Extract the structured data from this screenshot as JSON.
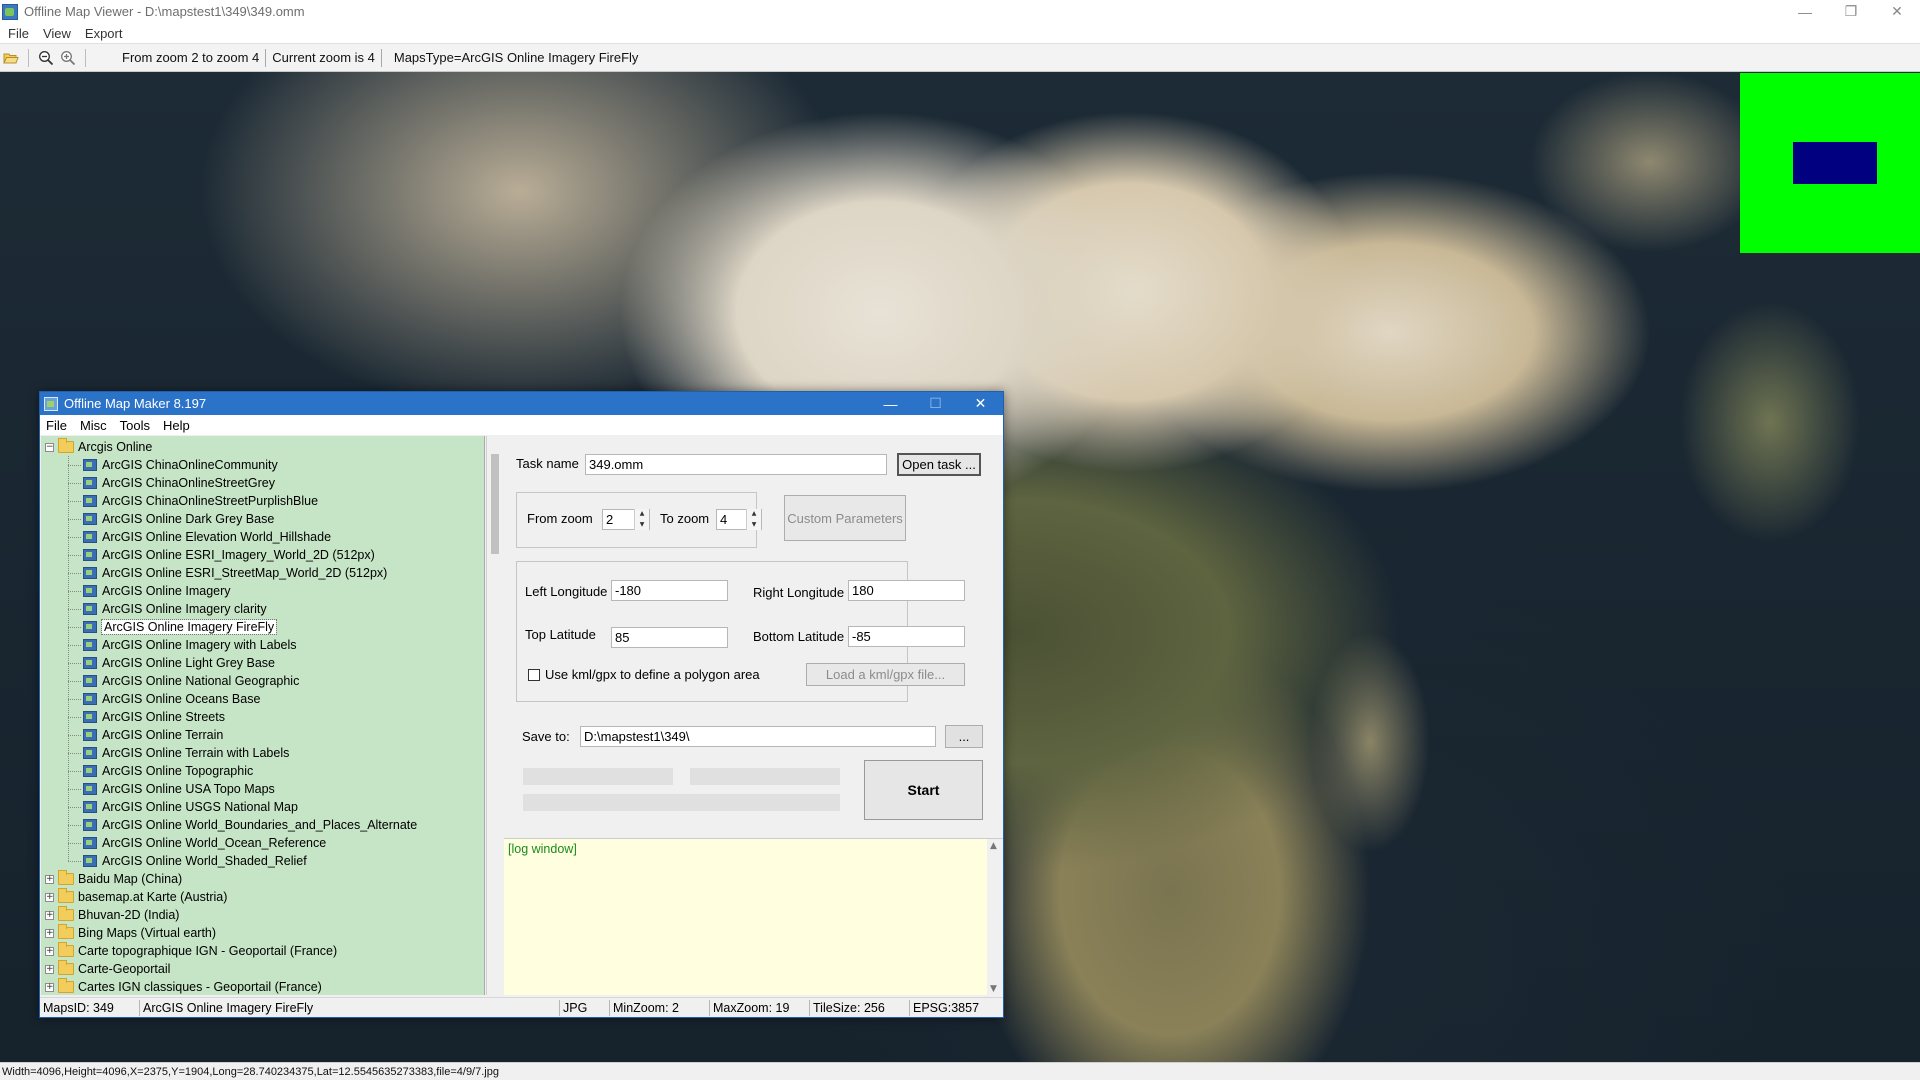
{
  "window": {
    "title": "Offline Map Viewer - D:\\mapstest1\\349\\349.omm",
    "controls": {
      "minimize": "—",
      "restore": "❐",
      "close": "✕"
    }
  },
  "menu": [
    "File",
    "View",
    "Export"
  ],
  "toolbar": {
    "zoom_range": "From zoom 2 to zoom 4",
    "current_zoom": "Current zoom is 4",
    "maps_type": "MapsType=ArcGIS Online Imagery FireFly"
  },
  "overlay_colors": {
    "outer": "#00ff00",
    "inner": "#000080"
  },
  "status_bar": "Width=4096,Height=4096,X=2375,Y=1904,Long=28.740234375,Lat=12.5545635273383,file=4/9/7.jpg",
  "dialog": {
    "title": "Offline Map Maker 8.197",
    "controls": {
      "minimize": "—",
      "maximize": "☐",
      "close": "✕"
    },
    "menu": [
      "File",
      "Misc",
      "Tools",
      "Help"
    ],
    "tree": {
      "root": "Arcgis Online",
      "children": [
        "ArcGIS ChinaOnlineCommunity",
        "ArcGIS ChinaOnlineStreetGrey",
        "ArcGIS ChinaOnlineStreetPurplishBlue",
        "ArcGIS Online Dark Grey Base",
        "ArcGIS Online Elevation World_Hillshade",
        "ArcGIS Online ESRI_Imagery_World_2D (512px)",
        "ArcGIS Online ESRI_StreetMap_World_2D (512px)",
        "ArcGIS Online Imagery",
        "ArcGIS Online Imagery clarity",
        "ArcGIS Online Imagery FireFly",
        "ArcGIS Online Imagery with Labels",
        "ArcGIS Online Light Grey Base",
        "ArcGIS Online National Geographic",
        "ArcGIS Online Oceans Base",
        "ArcGIS Online Streets",
        "ArcGIS Online Terrain",
        "ArcGIS Online Terrain with Labels",
        "ArcGIS Online Topographic",
        "ArcGIS Online USA Topo Maps",
        "ArcGIS Online USGS National Map",
        "ArcGIS Online World_Boundaries_and_Places_Alternate",
        "ArcGIS Online World_Ocean_Reference",
        "ArcGIS Online World_Shaded_Relief"
      ],
      "selected": "ArcGIS Online Imagery FireFly",
      "groups": [
        "Baidu Map (China)",
        "basemap.at Karte (Austria)",
        "Bhuvan-2D (India)",
        "Bing Maps (Virtual earth)",
        "Carte topographique IGN - Geoportail (France)",
        "Carte-Geoportail",
        "Cartes IGN classiques - Geoportail (France)"
      ]
    },
    "task": {
      "label": "Task name",
      "value": "349.omm",
      "open_button": "Open task ..."
    },
    "zoom": {
      "from_label": "From zoom",
      "from_value": "2",
      "to_label": "To zoom",
      "to_value": "4",
      "custom_button": "Custom Parameters"
    },
    "bounds": {
      "left_label": "Left Longitude",
      "left_value": "-180",
      "right_label": "Right Longitude",
      "right_value": "180",
      "top_label": "Top Latitude",
      "top_value": "85",
      "bottom_label": "Bottom Latitude",
      "bottom_value": "-85",
      "kml_label": "Use kml/gpx to define a polygon area",
      "kml_checked": false,
      "kml_button": "Load a kml/gpx file..."
    },
    "save": {
      "label": "Save to:",
      "value": "D:\\mapstest1\\349\\",
      "browse_button": "..."
    },
    "start_button": "Start",
    "log_text": "[log window]",
    "status": {
      "maps_id": "MapsID: 349",
      "map_name": "ArcGIS Online Imagery FireFly",
      "format": "JPG",
      "min_zoom": "MinZoom: 2",
      "max_zoom": "MaxZoom: 19",
      "tile_size": "TileSize: 256",
      "epsg": "EPSG:3857"
    }
  }
}
